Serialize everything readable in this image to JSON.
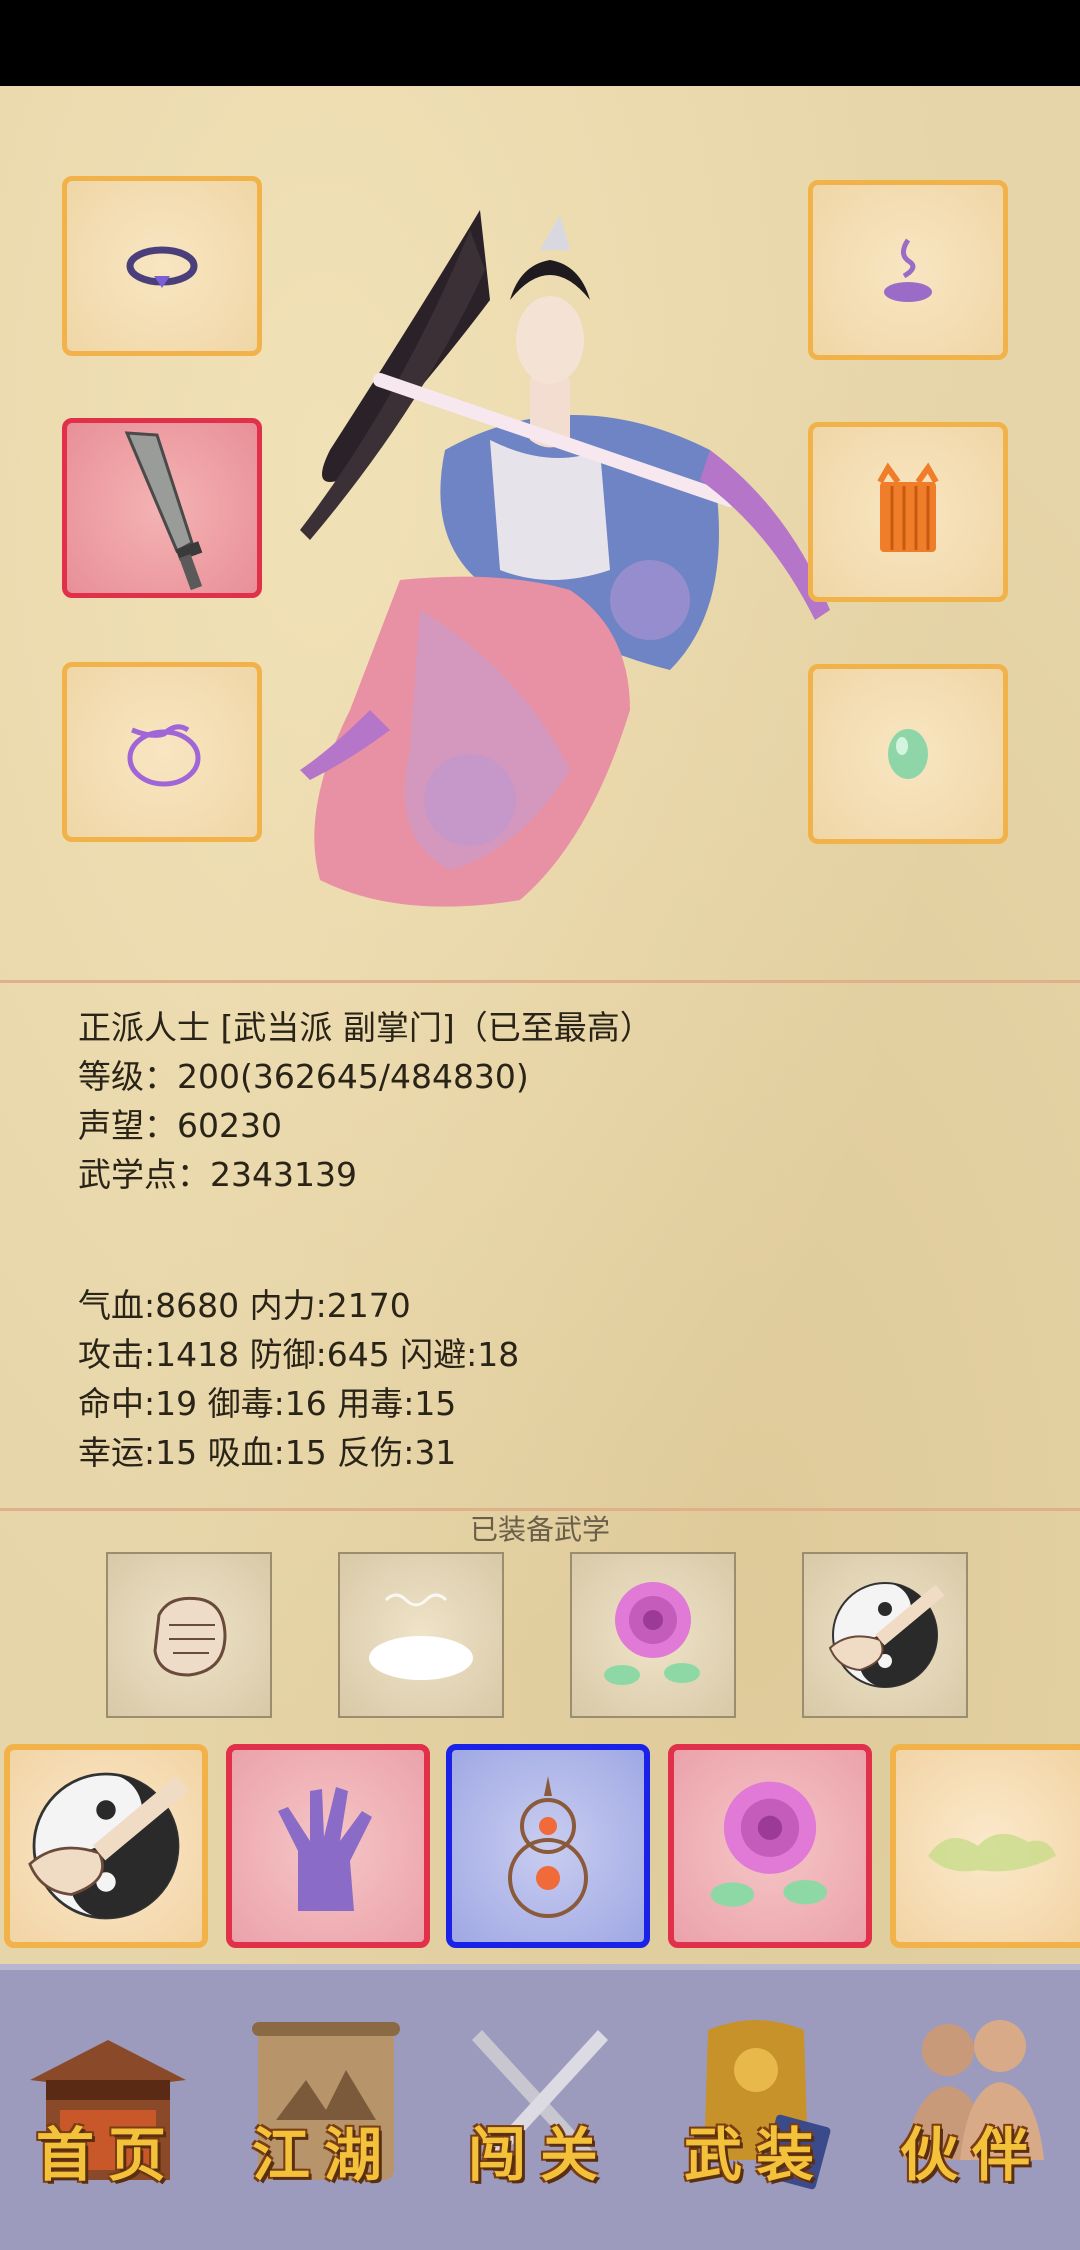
{
  "character": {
    "title_line": "正派人士 [武当派 副掌门]（已至最高）",
    "level_line": "等级：200(362645/484830)",
    "reputation_line": "声望：60230",
    "martial_points_line": "武学点：2343139"
  },
  "stats": {
    "row1": "气血:8680  内力:2170",
    "row2": "攻击:1418  防御:645  闪避:18",
    "row3": "命中:19  御毒:16  用毒:15",
    "row4": "幸运:15  吸血:15  反伤:31"
  },
  "equipped_skills_caption": "已装备武学",
  "equipment_icons": [
    "ring-icon",
    "incense-icon",
    "sword-icon",
    "armor-icon",
    "bracelet-icon",
    "jade-icon"
  ],
  "skill_icons": [
    "fist-icon",
    "cloud-icon",
    "rose-icon",
    "taiji-hand-icon"
  ],
  "card_icons": [
    "taiji-hand-icon",
    "purple-palm-icon",
    "gourd-icon",
    "rose-icon",
    "green-herb-icon"
  ],
  "nav": {
    "home": "首页",
    "jianghu": "江湖",
    "challenge": "闯关",
    "equipment": "武装",
    "partner": "伙伴"
  },
  "colors": {
    "slot_border": "#f2b24a",
    "selected_border": "#e0304a",
    "blue_border": "#1a22e8",
    "nav_text": "#f3c23a",
    "nav_bg": "#9d9bbd"
  }
}
